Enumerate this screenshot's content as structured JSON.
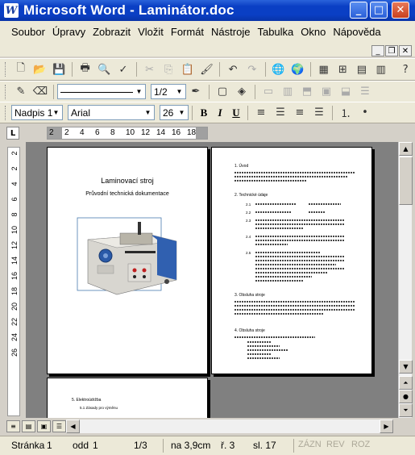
{
  "window": {
    "app_letter": "W",
    "title": "Microsoft Word - Laminátor.doc",
    "minimize": "_",
    "maximize": "□",
    "close": "✕"
  },
  "menu": {
    "items": [
      "Soubor",
      "Úpravy",
      "Zobrazit",
      "Vložit",
      "Formát",
      "Nástroje",
      "Tabulka",
      "Okno",
      "Nápověda"
    ]
  },
  "toolbar_format": {
    "style": "Nadpis 1",
    "font": "Arial",
    "size": "26",
    "bold": "B",
    "italic": "I",
    "underline": "U"
  },
  "toolbar_drawing": {
    "line_width": "1/2"
  },
  "ruler": {
    "tab_selector": "L",
    "numbers": [
      "2",
      "2",
      "4",
      "6",
      "8",
      "10",
      "12",
      "14",
      "16",
      "18"
    ]
  },
  "vruler": {
    "numbers": [
      "2",
      "2",
      "4",
      "6",
      "8",
      "10",
      "12",
      "14",
      "16",
      "18",
      "20",
      "22",
      "24",
      "26"
    ]
  },
  "document": {
    "page1_title": "Laminovací stroj",
    "page1_subtitle": "Průvodní technická dokumentace",
    "page2_headings": [
      "1. Úvod",
      "2. Technické údaje",
      "3. Obsluha stroje",
      "4. Obsluha stroje"
    ],
    "page2_labels": [
      "2.1",
      "2.2",
      "2.3",
      "2.4",
      "2.5"
    ],
    "page3_heading": "5. Elektroúdržba",
    "page3_sub": "5.1 Zásady pro výměnu"
  },
  "statusbar": {
    "page": "Stránka",
    "page_num": "1",
    "section": "odd",
    "section_num": "1",
    "pages": "1/3",
    "at": "na 3,9cm",
    "line": "ř. 3",
    "col": "sl. 17",
    "rec": "ZÁZN",
    "trk": "REV",
    "ext": "ROZ"
  }
}
